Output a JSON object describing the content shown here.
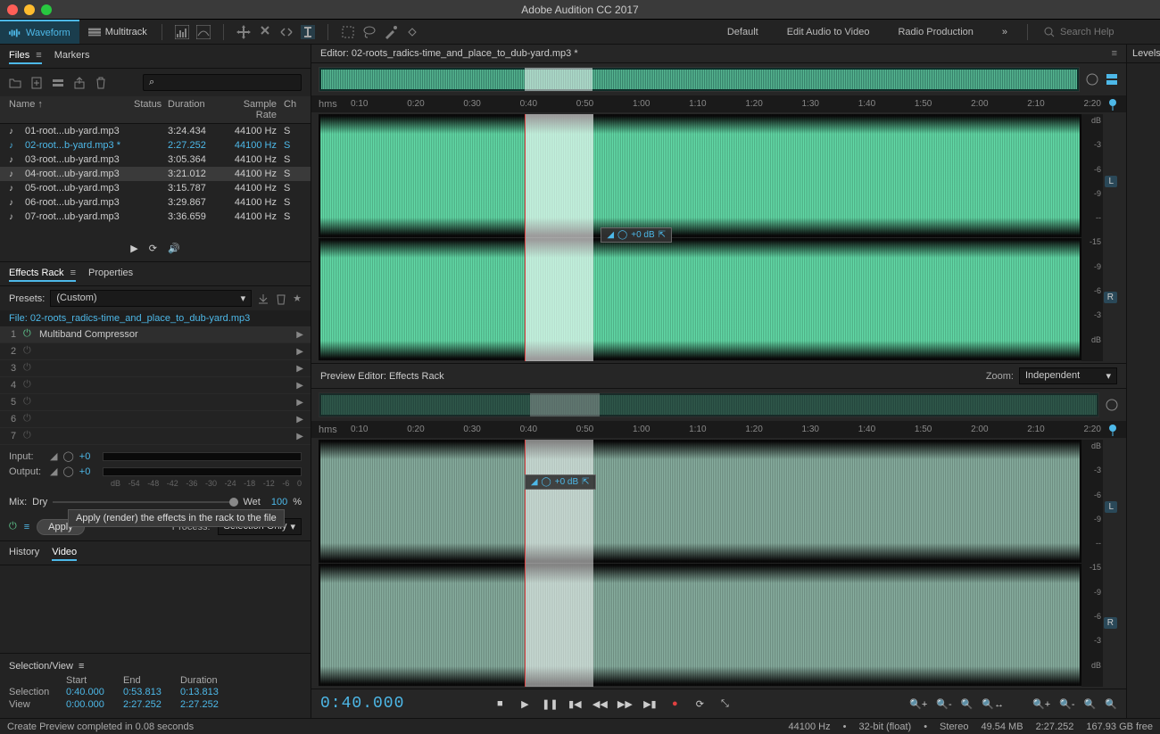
{
  "app_title": "Adobe Audition CC 2017",
  "toolbar": {
    "waveform_label": "Waveform",
    "multitrack_label": "Multitrack",
    "workspaces": [
      "Default",
      "Edit Audio to Video",
      "Radio Production"
    ],
    "search_placeholder": "Search Help"
  },
  "files_panel": {
    "tab_files": "Files",
    "tab_markers": "Markers",
    "columns": {
      "name": "Name ↑",
      "status": "Status",
      "duration": "Duration",
      "sample_rate": "Sample Rate",
      "channels": "Ch"
    },
    "rows": [
      {
        "name": "01-root...ub-yard.mp3",
        "status": "",
        "duration": "3:24.434",
        "rate": "44100 Hz",
        "active": false
      },
      {
        "name": "02-root...b-yard.mp3 *",
        "status": "",
        "duration": "2:27.252",
        "rate": "44100 Hz",
        "active": true
      },
      {
        "name": "03-root...ub-yard.mp3",
        "status": "",
        "duration": "3:05.364",
        "rate": "44100 Hz",
        "active": false
      },
      {
        "name": "04-root...ub-yard.mp3",
        "status": "",
        "duration": "3:21.012",
        "rate": "44100 Hz",
        "active": false,
        "selected": true
      },
      {
        "name": "05-root...ub-yard.mp3",
        "status": "",
        "duration": "3:15.787",
        "rate": "44100 Hz",
        "active": false
      },
      {
        "name": "06-root...ub-yard.mp3",
        "status": "",
        "duration": "3:29.867",
        "rate": "44100 Hz",
        "active": false
      },
      {
        "name": "07-root...ub-yard.mp3",
        "status": "",
        "duration": "3:36.659",
        "rate": "44100 Hz",
        "active": false
      }
    ]
  },
  "effects": {
    "tab_effects": "Effects Rack",
    "tab_properties": "Properties",
    "presets_label": "Presets:",
    "preset_value": "(Custom)",
    "file_label": "File: 02-roots_radics-time_and_place_to_dub-yard.mp3",
    "slots": [
      {
        "num": "1",
        "name": "Multiband Compressor",
        "on": true
      },
      {
        "num": "2",
        "name": "",
        "on": false
      },
      {
        "num": "3",
        "name": "",
        "on": false
      },
      {
        "num": "4",
        "name": "",
        "on": false
      },
      {
        "num": "5",
        "name": "",
        "on": false
      },
      {
        "num": "6",
        "name": "",
        "on": false
      },
      {
        "num": "7",
        "name": "",
        "on": false
      }
    ],
    "input_label": "Input:",
    "input_value": "+0",
    "output_label": "Output:",
    "output_value": "+0",
    "db_scale": [
      "dB",
      "-54",
      "-48",
      "-42",
      "-36",
      "-30",
      "-24",
      "-18",
      "-12",
      "-6",
      "0"
    ],
    "mix_label": "Mix:",
    "mix_dry": "Dry",
    "mix_wet": "Wet",
    "mix_pct": "100",
    "mix_pct_unit": "%",
    "apply_label": "Apply",
    "process_label": "Process:",
    "process_value": "Selection Only",
    "tooltip": "Apply (render) the effects in the rack to the file"
  },
  "history": {
    "tab_history": "History",
    "tab_video": "Video"
  },
  "selview": {
    "label": "Selection/View",
    "start": "Start",
    "end": "End",
    "duration": "Duration",
    "sel_label": "Selection",
    "sel_start": "0:40.000",
    "sel_end": "0:53.813",
    "sel_dur": "0:13.813",
    "view_label": "View",
    "view_start": "0:00.000",
    "view_end": "2:27.252",
    "view_dur": "2:27.252"
  },
  "editor": {
    "title": "Editor: 02-roots_radics-time_and_place_to_dub-yard.mp3 *",
    "timeline_unit": "hms",
    "timeline_ticks": [
      "0:10",
      "0:20",
      "0:30",
      "0:40",
      "0:50",
      "1:00",
      "1:10",
      "1:20",
      "1:30",
      "1:40",
      "1:50",
      "2:00",
      "2:10",
      "2:20"
    ],
    "hud_gain": "+0 dB",
    "db_scale": [
      "dB",
      "-3",
      "-6",
      "-9",
      "--",
      "-15",
      "-9",
      "-6",
      "-3",
      "dB"
    ],
    "channel_l": "L",
    "channel_r": "R"
  },
  "preview": {
    "title": "Preview Editor: Effects Rack",
    "zoom_label": "Zoom:",
    "zoom_value": "Independent",
    "hud_gain": "+0 dB"
  },
  "transport": {
    "timecode": "0:40.000"
  },
  "levels": {
    "label": "Levels"
  },
  "statusbar": {
    "message": "Create Preview completed in 0.08 seconds",
    "sample_rate": "44100 Hz",
    "bit_depth": "32-bit (float)",
    "channels": "Stereo",
    "file_size": "49.54 MB",
    "duration": "2:27.252",
    "disk_free": "167.93 GB free"
  }
}
